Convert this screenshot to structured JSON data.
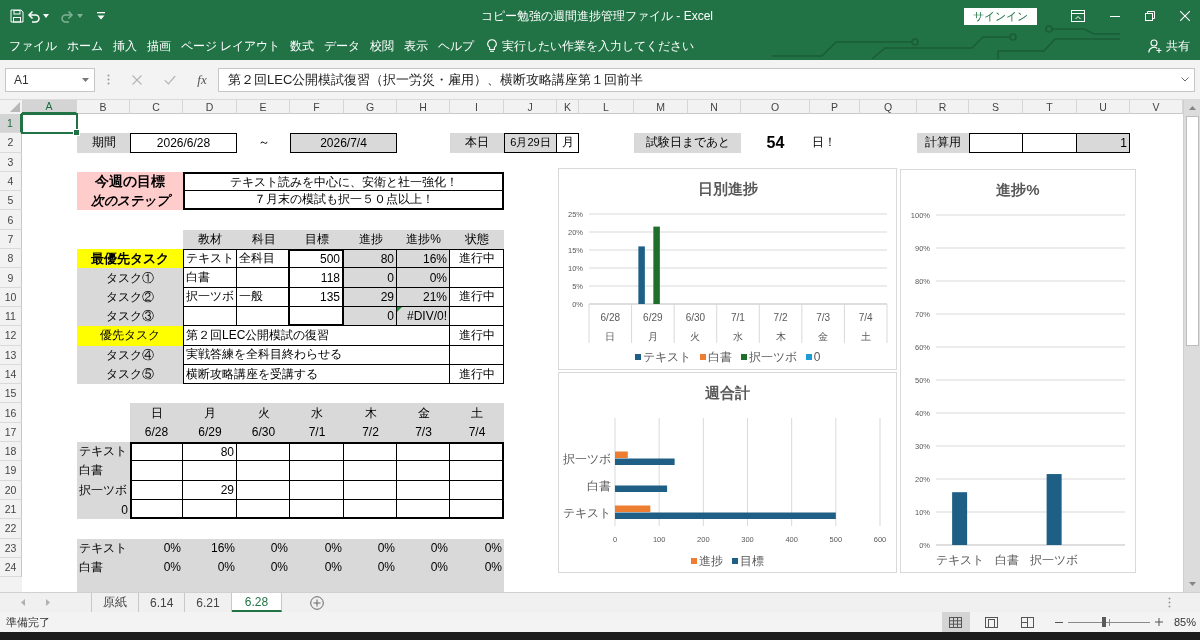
{
  "title_bar": {
    "title": "コピー勉強の週間進捗管理ファイル - Excel",
    "sign_in": "サインイン"
  },
  "ribbon": {
    "tabs": [
      "ファイル",
      "ホーム",
      "挿入",
      "描画",
      "ページ レイアウト",
      "数式",
      "データ",
      "校閲",
      "表示",
      "ヘルプ"
    ],
    "tell_me": "実行したい作業を入力してください",
    "share": "共有"
  },
  "formula_bar": {
    "name_box": "A1",
    "function_button": "fx",
    "formula": "第２回LEC公開模試復習（択一労災・雇用）、横断攻略講座第１回前半"
  },
  "columns": [
    {
      "label": "A",
      "selected": true
    },
    {
      "label": "B",
      "selected": false
    },
    {
      "label": "C",
      "selected": false
    },
    {
      "label": "D",
      "selected": false
    },
    {
      "label": "E",
      "selected": false
    },
    {
      "label": "F",
      "selected": false
    },
    {
      "label": "G",
      "selected": false
    },
    {
      "label": "H",
      "selected": false
    },
    {
      "label": "I",
      "selected": false
    },
    {
      "label": "J",
      "selected": false
    },
    {
      "label": "K",
      "selected": false
    },
    {
      "label": "L",
      "selected": false
    },
    {
      "label": "M",
      "selected": false
    },
    {
      "label": "N",
      "selected": false
    },
    {
      "label": "O",
      "selected": false
    },
    {
      "label": "P",
      "selected": false
    },
    {
      "label": "Q",
      "selected": false
    },
    {
      "label": "R",
      "selected": false
    },
    {
      "label": "S",
      "selected": false
    },
    {
      "label": "T",
      "selected": false
    },
    {
      "label": "U",
      "selected": false
    },
    {
      "label": "V",
      "selected": false
    }
  ],
  "rows": [
    {
      "label": "1",
      "selected": true
    },
    {
      "label": "2",
      "selected": false
    },
    {
      "label": "3",
      "selected": false
    },
    {
      "label": "4",
      "selected": false
    },
    {
      "label": "5",
      "selected": false
    },
    {
      "label": "6",
      "selected": false
    },
    {
      "label": "7",
      "selected": false
    },
    {
      "label": "8",
      "selected": false
    },
    {
      "label": "9",
      "selected": false
    },
    {
      "label": "10",
      "selected": false
    },
    {
      "label": "11",
      "selected": false
    },
    {
      "label": "12",
      "selected": false
    },
    {
      "label": "13",
      "selected": false
    },
    {
      "label": "14",
      "selected": false
    },
    {
      "label": "15",
      "selected": false
    },
    {
      "label": "16",
      "selected": false
    },
    {
      "label": "17",
      "selected": false
    },
    {
      "label": "18",
      "selected": false
    },
    {
      "label": "19",
      "selected": false
    },
    {
      "label": "20",
      "selected": false
    },
    {
      "label": "21",
      "selected": false
    },
    {
      "label": "22",
      "selected": false
    },
    {
      "label": "23",
      "selected": false
    },
    {
      "label": "24",
      "selected": false
    }
  ],
  "period": {
    "label": "期間",
    "start": "2026/6/28",
    "separator": "～",
    "end": "2026/7/4"
  },
  "today": {
    "label": "本日",
    "date": "6月29日",
    "weekday": "月"
  },
  "countdown": {
    "label": "試験日まであと",
    "days": "54",
    "suffix": "日！"
  },
  "calc": {
    "label": "計算用",
    "value": "1"
  },
  "goals": [
    {
      "label": "今週の目標",
      "italic": false,
      "text": "テキスト読みを中心に、安衛と社一強化！"
    },
    {
      "label": "次のステップ",
      "italic": true,
      "text": "７月末の模試も択一５０点以上！"
    }
  ],
  "tasks": {
    "columns": [
      "教材",
      "科目",
      "目標",
      "進捗",
      "進捗%",
      "状態"
    ],
    "rows": [
      {
        "kind": "material",
        "label": "最優先タスク",
        "priority": true,
        "bold": true,
        "material": "テキスト",
        "subject": "全科目",
        "target": "500",
        "progress": "80",
        "percent": "16%",
        "percent_error": false,
        "status": "進行中"
      },
      {
        "kind": "material",
        "label": "タスク①",
        "priority": false,
        "bold": false,
        "material": "白書",
        "target": "118",
        "progress": "0",
        "percent": "0%",
        "percent_error": false
      },
      {
        "kind": "material",
        "label": "タスク②",
        "priority": false,
        "bold": false,
        "material": "択一ツボ",
        "subject": "一般",
        "target": "135",
        "progress": "29",
        "percent": "21%",
        "percent_error": false,
        "status": "進行中"
      },
      {
        "kind": "material",
        "label": "タスク③",
        "priority": false,
        "bold": false,
        "progress": "0",
        "percent": "#DIV/0!",
        "percent_error": true
      },
      {
        "kind": "activity",
        "label": "優先タスク",
        "priority": true,
        "bold": false,
        "description": "第２回LEC公開模試の復習",
        "status": "進行中"
      },
      {
        "kind": "activity",
        "label": "タスク④",
        "priority": false,
        "bold": false,
        "description": "実戦答練を全科目終わらせる"
      },
      {
        "kind": "activity",
        "label": "タスク⑤",
        "priority": false,
        "bold": false,
        "description": "横断攻略講座を受講する",
        "status": "進行中"
      }
    ]
  },
  "daily": {
    "days": [
      {
        "weekday": "日",
        "date": "6/28"
      },
      {
        "weekday": "月",
        "date": "6/29"
      },
      {
        "weekday": "火",
        "date": "6/30"
      },
      {
        "weekday": "水",
        "date": "7/1"
      },
      {
        "weekday": "木",
        "date": "7/2"
      },
      {
        "weekday": "金",
        "date": "7/3"
      },
      {
        "weekday": "土",
        "date": "7/4"
      }
    ],
    "rows": [
      {
        "label": "テキスト",
        "kind": "text",
        "cells": [
          {
            "kind": "blank"
          },
          {
            "kind": "value",
            "value": "80"
          },
          {
            "kind": "blank"
          },
          {
            "kind": "blank"
          },
          {
            "kind": "blank"
          },
          {
            "kind": "blank"
          },
          {
            "kind": "blank"
          }
        ]
      },
      {
        "label": "白書",
        "kind": "text",
        "cells": [
          {
            "kind": "blank"
          },
          {
            "kind": "blank"
          },
          {
            "kind": "blank"
          },
          {
            "kind": "blank"
          },
          {
            "kind": "blank"
          },
          {
            "kind": "blank"
          },
          {
            "kind": "blank"
          }
        ]
      },
      {
        "label": "択一ツボ",
        "kind": "text",
        "cells": [
          {
            "kind": "blank"
          },
          {
            "kind": "value",
            "value": "29"
          },
          {
            "kind": "blank"
          },
          {
            "kind": "blank"
          },
          {
            "kind": "blank"
          },
          {
            "kind": "blank"
          },
          {
            "kind": "blank"
          }
        ]
      },
      {
        "label": "0",
        "kind": "number",
        "cells": [
          {
            "kind": "blank"
          },
          {
            "kind": "blank"
          },
          {
            "kind": "blank"
          },
          {
            "kind": "blank"
          },
          {
            "kind": "blank"
          },
          {
            "kind": "blank"
          },
          {
            "kind": "blank"
          }
        ]
      }
    ]
  },
  "percent_rows": [
    {
      "label": "テキスト",
      "values": [
        "0%",
        "16%",
        "0%",
        "0%",
        "0%",
        "0%",
        "0%"
      ]
    },
    {
      "label": "白書",
      "values": [
        "0%",
        "0%",
        "0%",
        "0%",
        "0%",
        "0%",
        "0%"
      ]
    }
  ],
  "charts": [
    {
      "chart_data": {
        "type": "bar",
        "title": "日別進捗",
        "categories": [
          "6/28\n日",
          "6/29\n月",
          "6/30\n火",
          "7/1\n水",
          "7/2\n木",
          "7/3\n金",
          "7/4\n土"
        ],
        "series": [
          {
            "name": "テキスト",
            "color": "#1f5f86",
            "values": [
              0,
              0.16,
              0,
              0,
              0,
              0,
              0
            ]
          },
          {
            "name": "白書",
            "color": "#ed7d31",
            "values": [
              0,
              0,
              0,
              0,
              0,
              0,
              0
            ]
          },
          {
            "name": "択一ツボ",
            "color": "#1e6e2c",
            "values": [
              0,
              0.215,
              0,
              0,
              0,
              0,
              0
            ]
          },
          {
            "name": "0",
            "color": "#1e9bd7",
            "values": [
              0,
              0,
              0,
              0,
              0,
              0,
              0
            ]
          }
        ],
        "ylim": [
          0,
          0.25
        ],
        "yticks": [
          {
            "value": 0,
            "label": "0%"
          },
          {
            "value": 0.05,
            "label": "5%"
          },
          {
            "value": 0.1,
            "label": "10%"
          },
          {
            "value": 0.15,
            "label": "15%"
          },
          {
            "value": 0.2,
            "label": "20%"
          },
          {
            "value": 0.25,
            "label": "25%"
          }
        ],
        "grid": true,
        "legend": "bottom"
      }
    },
    {
      "chart_data": {
        "type": "bar",
        "orientation": "horizontal",
        "title": "週合計",
        "categories": [
          null,
          "択一ツボ",
          "白書",
          "テキスト"
        ],
        "series": [
          {
            "name": "進捗",
            "color": "#ed7d31",
            "values": [
              null,
              29,
              0,
              80
            ]
          },
          {
            "name": "目標",
            "color": "#1f5f86",
            "values": [
              null,
              135,
              118,
              500
            ]
          }
        ],
        "xlim": [
          0,
          600
        ],
        "xticks": [
          0,
          100,
          200,
          300,
          400,
          500,
          600
        ],
        "grid": true,
        "legend": "bottom"
      }
    },
    {
      "chart_data": {
        "type": "bar",
        "title": "進捗%",
        "categories": [
          "テキスト",
          "白書",
          "択一ツボ",
          null
        ],
        "series": [
          {
            "color": "#1f5f86",
            "values": [
              0.16,
              0,
              0.215,
              null
            ]
          }
        ],
        "ylim": [
          0,
          1
        ],
        "yticks": [
          {
            "value": 0,
            "label": "0%"
          },
          {
            "value": 0.1,
            "label": "10%"
          },
          {
            "value": 0.2,
            "label": "20%"
          },
          {
            "value": 0.3,
            "label": "30%"
          },
          {
            "value": 0.4,
            "label": "40%"
          },
          {
            "value": 0.5,
            "label": "50%"
          },
          {
            "value": 0.6,
            "label": "60%"
          },
          {
            "value": 0.7,
            "label": "70%"
          },
          {
            "value": 0.8,
            "label": "80%"
          },
          {
            "value": 0.9,
            "label": "90%"
          },
          {
            "value": 1,
            "label": "100%"
          }
        ],
        "grid": true
      }
    }
  ],
  "sheet_tabs": [
    {
      "label": "原紙",
      "selected": false
    },
    {
      "label": "6.14",
      "selected": false
    },
    {
      "label": "6.21",
      "selected": false
    },
    {
      "label": "6.28",
      "selected": true
    }
  ],
  "status_bar": {
    "text": "準備完了",
    "views": [
      {
        "kind": "normal",
        "selected": true
      },
      {
        "kind": "page_layout",
        "selected": false
      },
      {
        "kind": "page_break",
        "selected": false
      }
    ],
    "zoom": {
      "level": 0.44,
      "reading": "85%"
    }
  }
}
